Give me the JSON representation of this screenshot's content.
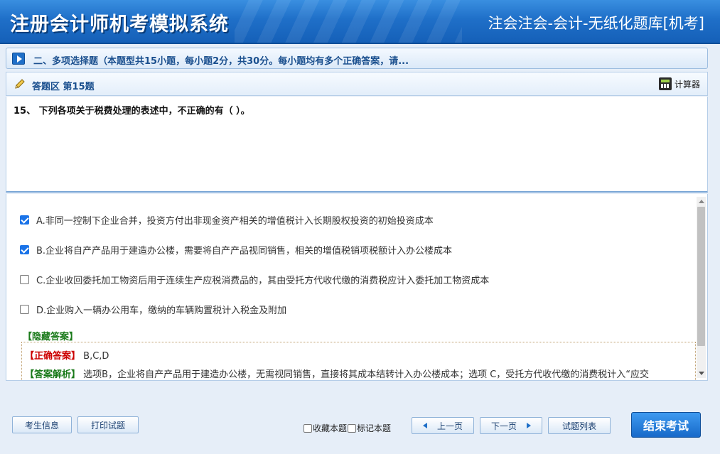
{
  "header": {
    "brand": "注册会计师机考模拟系统",
    "right_title": "注会注会-会计-无纸化题库[机考]"
  },
  "section": {
    "title": "二、多项选择题（本题型共15小题，每小题2分，共30分。每小题均有多个正确答案，请..."
  },
  "question_header": {
    "label": "答题区 第15题",
    "calculator_label": "计算器"
  },
  "question": {
    "stem": "15、 下列各项关于税费处理的表述中，不正确的有（ ）。"
  },
  "options": [
    {
      "text": "A.非同一控制下企业合并，投资方付出非现金资产相关的增值税计入长期股权投资的初始投资成本",
      "checked": true
    },
    {
      "text": "B.企业将自产产品用于建造办公楼，需要将自产产品视同销售，相关的增值税销项税额计入办公楼成本",
      "checked": true
    },
    {
      "text": "C.企业收回委托加工物资后用于连续生产应税消费品的，其由受托方代收代缴的消费税应计入委托加工物资成本",
      "checked": false
    },
    {
      "text": "D.企业购入一辆办公用车，缴纳的车辆购置税计入税金及附加",
      "checked": false
    }
  ],
  "answer": {
    "hidden_label": "【隐藏答案】",
    "correct_label": "【正确答案】",
    "correct_value": "B,C,D",
    "analysis_label": "【答案解析】",
    "analysis_text": "选项B，企业将自产产品用于建造办公楼，无需视同销售，直接将其成本结转计入办公楼成本；选项 C，受托方代收代缴的消费税计入“应交"
  },
  "footer": {
    "student_info": "考生信息",
    "print": "打印试题",
    "favorite": "收藏本题",
    "mark": "标记本题",
    "prev": "上一页",
    "next": "下一页",
    "list": "试题列表",
    "end": "结束考试"
  }
}
